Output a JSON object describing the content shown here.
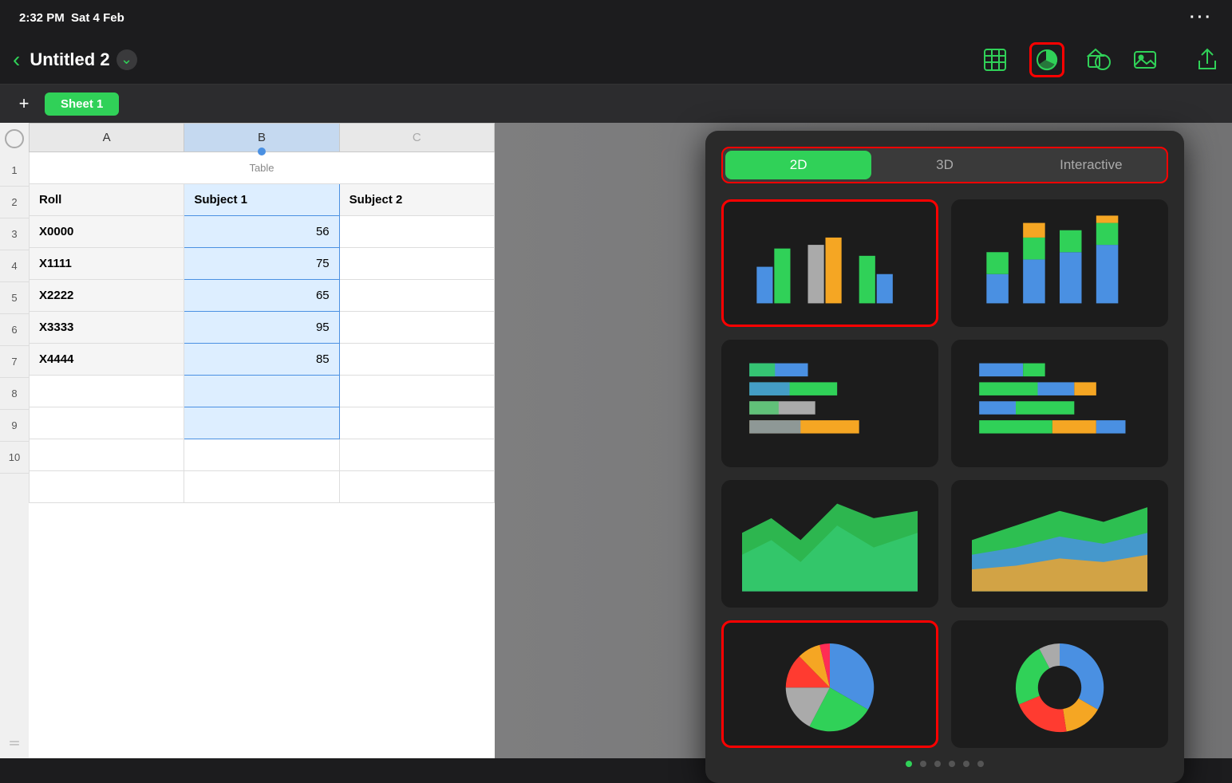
{
  "statusBar": {
    "time": "2:32 PM",
    "date": "Sat 4 Feb",
    "dots": "···"
  },
  "toolbar": {
    "backLabel": "‹",
    "title": "Untitled 2",
    "chevron": "⌄"
  },
  "sheetTabs": {
    "addLabel": "+",
    "tabs": [
      "Sheet 1"
    ]
  },
  "spreadsheet": {
    "colHeaders": [
      "A",
      "B",
      "C"
    ],
    "tableCaption": "Table",
    "rows": [
      {
        "num": 1,
        "cells": [
          "Roll",
          "Subject 1",
          "Subject 2"
        ]
      },
      {
        "num": 2,
        "cells": [
          "X0000",
          "56",
          ""
        ]
      },
      {
        "num": 3,
        "cells": [
          "X1111",
          "75",
          ""
        ]
      },
      {
        "num": 4,
        "cells": [
          "X2222",
          "65",
          ""
        ]
      },
      {
        "num": 5,
        "cells": [
          "X3333",
          "95",
          ""
        ]
      },
      {
        "num": 6,
        "cells": [
          "X4444",
          "85",
          ""
        ]
      },
      {
        "num": 7,
        "cells": [
          "",
          "",
          ""
        ]
      },
      {
        "num": 8,
        "cells": [
          "",
          "",
          ""
        ]
      },
      {
        "num": 9,
        "cells": [
          "",
          "",
          ""
        ]
      },
      {
        "num": 10,
        "cells": [
          "",
          "",
          ""
        ]
      }
    ]
  },
  "chartPicker": {
    "tabs": [
      "2D",
      "3D",
      "Interactive"
    ],
    "activeTab": "2D",
    "charts": [
      {
        "id": "bar-grouped",
        "label": "Grouped Bar",
        "selected": true
      },
      {
        "id": "bar-stacked",
        "label": "Stacked Bar",
        "selected": false
      },
      {
        "id": "bar-horizontal",
        "label": "Horizontal Bar",
        "selected": false
      },
      {
        "id": "bar-horizontal-stacked",
        "label": "Horizontal Stacked Bar",
        "selected": false
      },
      {
        "id": "area",
        "label": "Area",
        "selected": false
      },
      {
        "id": "area-stacked",
        "label": "Stacked Area",
        "selected": false
      },
      {
        "id": "pie",
        "label": "Pie",
        "selected": true
      },
      {
        "id": "donut",
        "label": "Donut",
        "selected": false
      }
    ],
    "paginationDots": 6,
    "activeDot": 0
  },
  "colors": {
    "green": "#30d158",
    "blue": "#4a90e2",
    "accent": "#30d158",
    "red": "#ff3b30"
  }
}
